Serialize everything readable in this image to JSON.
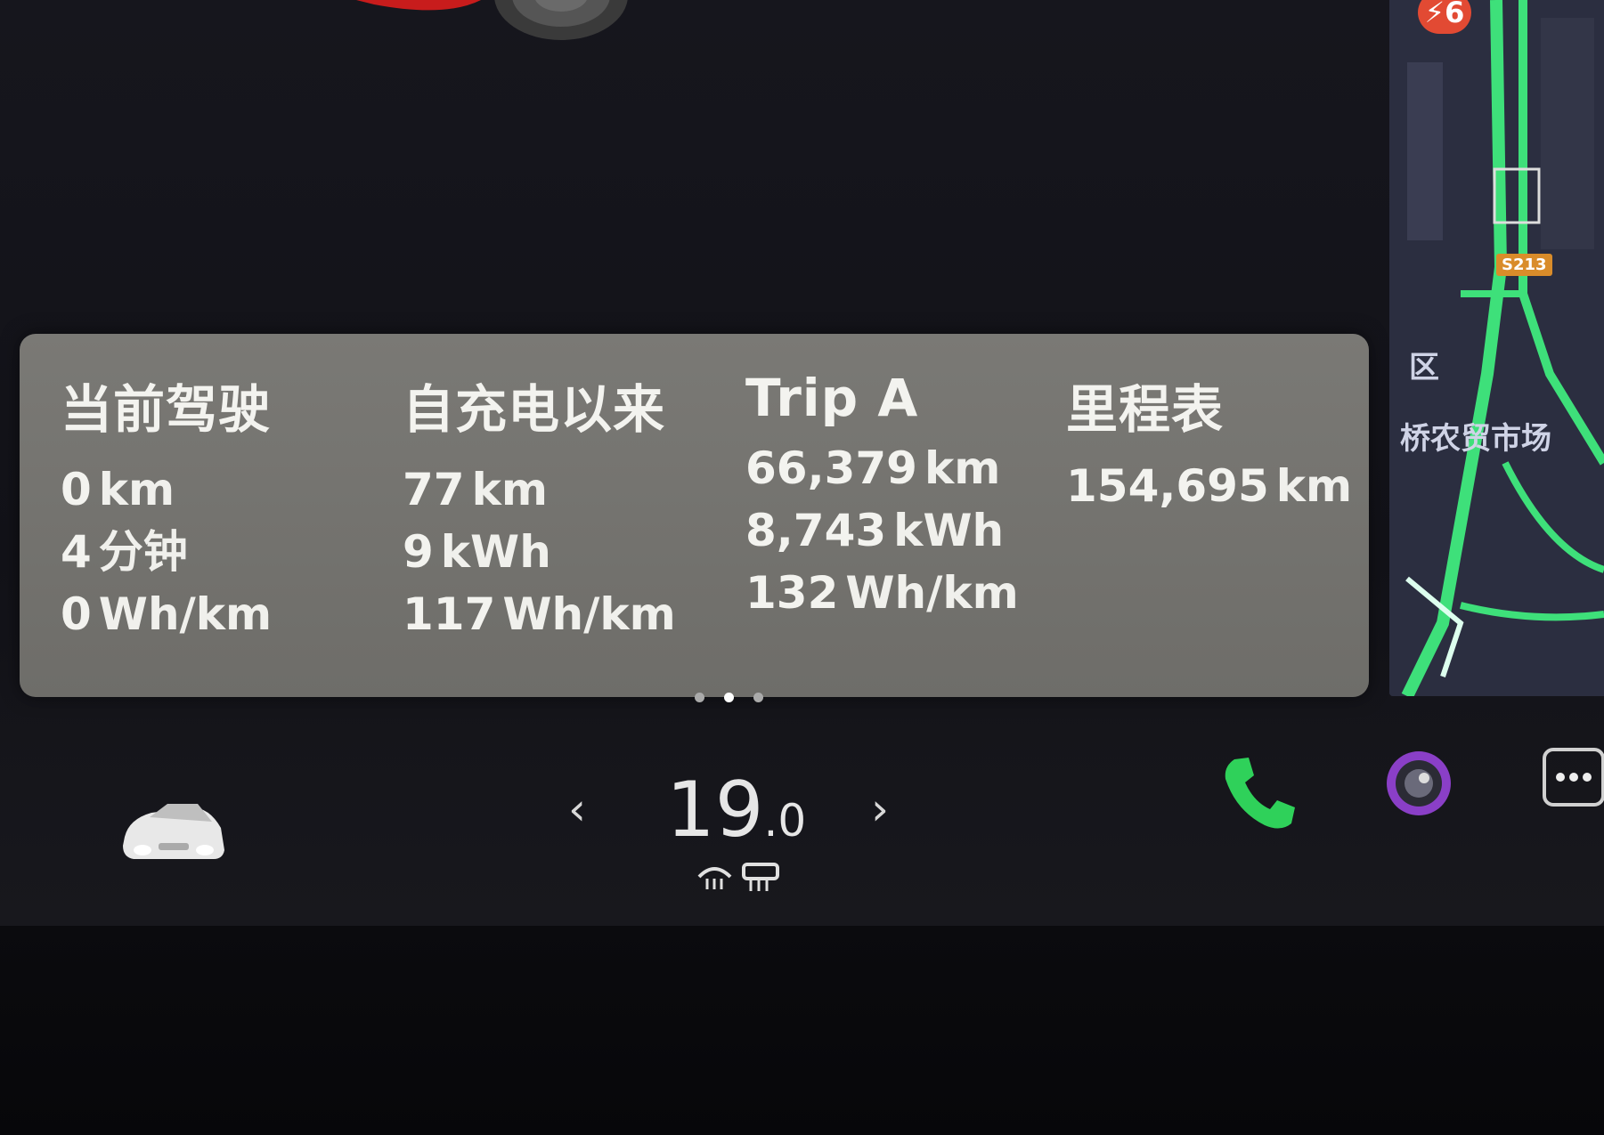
{
  "trip_panel": {
    "columns": [
      {
        "title": "当前驾驶",
        "rows": [
          {
            "value": "0",
            "unit": "km"
          },
          {
            "value": "4",
            "unit": "分钟"
          },
          {
            "value": "0",
            "unit": "Wh/km"
          }
        ]
      },
      {
        "title": "自充电以来",
        "rows": [
          {
            "value": "77",
            "unit": "km"
          },
          {
            "value": "9",
            "unit": "kWh"
          },
          {
            "value": "117",
            "unit": "Wh/km"
          }
        ]
      },
      {
        "title": "Trip A",
        "rows": [
          {
            "value": "66,379",
            "unit": "km"
          },
          {
            "value": "8,743",
            "unit": "kWh"
          },
          {
            "value": "132",
            "unit": "Wh/km"
          }
        ]
      },
      {
        "title": "里程表",
        "rows": [
          {
            "value": "154,695",
            "unit": "km"
          }
        ]
      }
    ],
    "page_dots": {
      "count": 3,
      "active_index": 1
    }
  },
  "map": {
    "road_badge": "S213",
    "labels": [
      "区",
      "桥农贸市场"
    ],
    "alert_badge": "6"
  },
  "bottom_bar": {
    "temperature_whole": "19",
    "temperature_decimal": ".0",
    "arrow_left": "‹",
    "arrow_right": "›",
    "icons": [
      "car-icon",
      "defrost-front-icon",
      "defrost-rear-icon",
      "phone-icon",
      "camera-icon",
      "more-icon"
    ]
  },
  "colors": {
    "card": "#74736f",
    "screen": "#15151b",
    "phone_green": "#2fd15a",
    "route_green": "#3ee07a",
    "camera_purple": "#8a3fc7"
  }
}
